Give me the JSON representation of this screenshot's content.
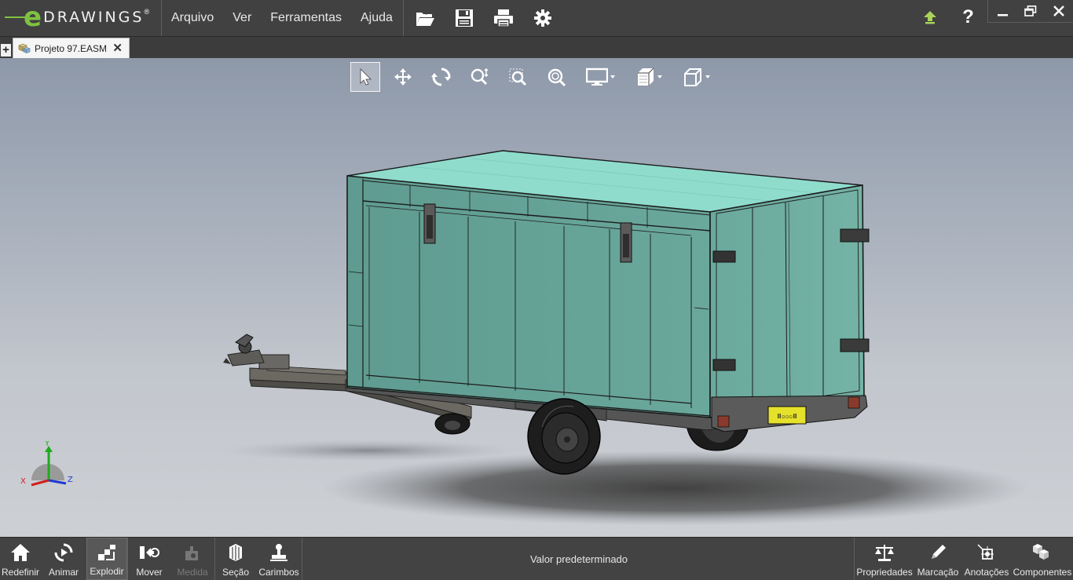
{
  "app": {
    "logo_text": "DRAWINGS",
    "logo_letter": "e",
    "accent_color": "#7fc241"
  },
  "menu": {
    "items": [
      {
        "label": "Arquivo"
      },
      {
        "label": "Ver"
      },
      {
        "label": "Ferramentas"
      },
      {
        "label": "Ajuda"
      }
    ]
  },
  "toolbar_icons": [
    "open-folder-icon",
    "save-icon",
    "print-icon",
    "settings-gear-icon"
  ],
  "tabs": [
    {
      "label": "Projeto 97.EASM",
      "close": "✕",
      "active": true
    }
  ],
  "tab_add_label": "+",
  "help_label": "?",
  "view_toolbar_icons": [
    "select-arrow-icon",
    "pan-icon",
    "rotate-icon",
    "zoom-to-fit-icon",
    "zoom-to-area-icon",
    "zoom-icon",
    "display-style-icon",
    "shaded-view-icon",
    "view-orientation-icon"
  ],
  "model": {
    "plate_text": "Ⅲ▫▫▫Ⅲ",
    "triad": {
      "x": "X",
      "y": "Y",
      "z": "Z"
    }
  },
  "bottom": {
    "left_buttons": [
      {
        "label": "Redefinir",
        "icon": "home-icon"
      },
      {
        "label": "Animar",
        "icon": "animate-icon"
      },
      {
        "label": "Explodir",
        "icon": "explode-icon",
        "active": true
      },
      {
        "label": "Mover",
        "icon": "move-component-icon"
      },
      {
        "label": "Medida",
        "icon": "measure-icon",
        "disabled": true
      },
      {
        "label": "Seção",
        "icon": "section-icon"
      },
      {
        "label": "Carimbos",
        "icon": "stamp-icon"
      }
    ],
    "status": "Valor predeterminado",
    "right_buttons": [
      {
        "label": "Propriedades",
        "icon": "properties-scale-icon"
      },
      {
        "label": "Marcação",
        "icon": "markup-pencil-icon"
      },
      {
        "label": "Anotações",
        "icon": "annotations-icon"
      },
      {
        "label": "Componentes",
        "icon": "components-cubes-icon"
      }
    ]
  }
}
